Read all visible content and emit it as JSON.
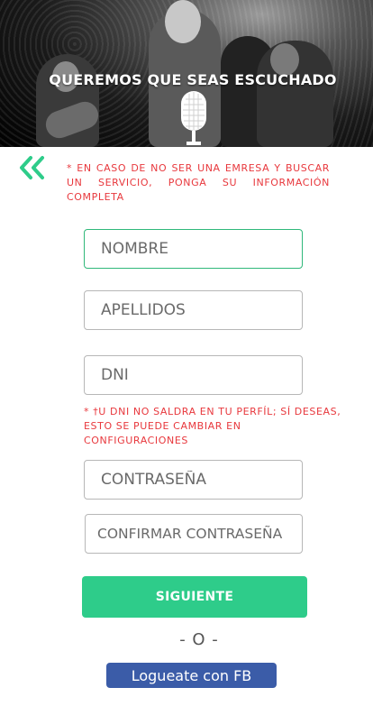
{
  "hero": {
    "title": "QUEREMOS QUE SEAS ESCUCHADO"
  },
  "back": {
    "icon": "double-chevron-left-icon"
  },
  "notice": {
    "text": "* EN CASO DE NO SER UNA EMRESA Y BUSCAR UN SERVICIO, PONGA SU INFORMACIÓN COMPLETA"
  },
  "form": {
    "nombre_placeholder": "NOMBRE",
    "apellidos_placeholder": "APELLIDOS",
    "dni_placeholder": "DNI",
    "dni_note": "* †U DNI NO SALDRA EN TU PERFÍL; SÍ DESEAS, ESTO SE PUEDE CAMBIAR EN CONFIGURACIONES",
    "password_placeholder": "CONTRASEÑA",
    "confirm_placeholder": "CONFIRMAR CONTRASEÑA"
  },
  "actions": {
    "next_label": "SIGUIENTE",
    "divider": "- O -",
    "facebook_label": "Logueate con FB"
  },
  "colors": {
    "accent": "#2ecc8a",
    "error": "#e8383d",
    "facebook": "#3b5ca8"
  }
}
